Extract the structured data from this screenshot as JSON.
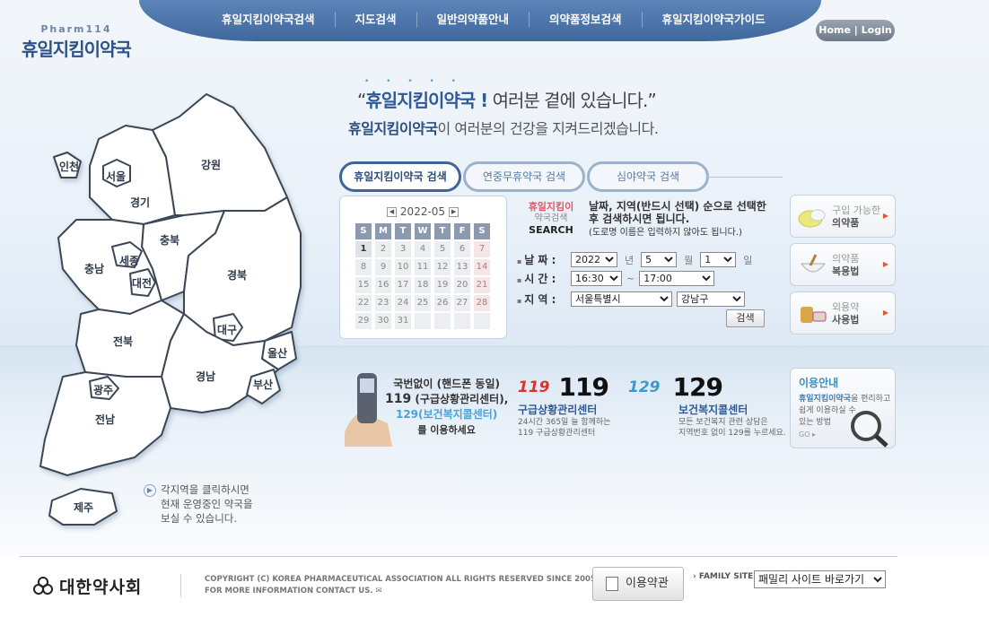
{
  "header": {
    "logo_sub": "Pharm114",
    "logo_main": "휴일지킴이약국",
    "home_login": "Home | Login",
    "nav": [
      "휴일지킴이약국검색",
      "지도검색",
      "일반의약품안내",
      "의약품정보검색",
      "휴일지킴이약국가이드"
    ]
  },
  "hero": {
    "headline_brand": "휴일지킴이약국 !",
    "headline_rest": "여러분 곁에 있습니다.",
    "headline_dots": "• • • • •",
    "sub_brand": "휴일지킴이약국",
    "sub_rest": "이 여러분의 건강을 지켜드리겠습니다."
  },
  "map": {
    "regions": [
      "인천",
      "서울",
      "경기",
      "강원",
      "충북",
      "충남",
      "세종",
      "대전",
      "경북",
      "대구",
      "울산",
      "전북",
      "경남",
      "광주",
      "부산",
      "전남",
      "제주"
    ],
    "note": [
      "각지역을 클릭하시면",
      "현재 운영중인 약국을",
      "보실 수 있습니다."
    ]
  },
  "tabs": [
    "휴일지킴이약국 검색",
    "연중무휴약국 검색",
    "심야약국 검색"
  ],
  "calendar": {
    "month": "2022-05",
    "dow": [
      "S",
      "M",
      "T",
      "W",
      "T",
      "F",
      "S"
    ],
    "days": [
      "1",
      "2",
      "3",
      "4",
      "5",
      "6",
      "7",
      "8",
      "9",
      "10",
      "11",
      "12",
      "13",
      "14",
      "15",
      "16",
      "17",
      "18",
      "19",
      "20",
      "21",
      "22",
      "23",
      "24",
      "25",
      "26",
      "27",
      "28",
      "29",
      "30",
      "31",
      "",
      "",
      "",
      ""
    ]
  },
  "search": {
    "logo_line1": "휴일지킴이",
    "logo_line2": "약국검색",
    "logo_line3": "SEARCH",
    "desc1": "날짜, 지역(반드시 선택) 순으로 선택한",
    "desc2": "후 검색하시면 됩니다.",
    "desc3": "(도로명 이름은 입력하지 않아도 됩니다.)",
    "date_label": "날 짜 :",
    "year": "2022",
    "year_unit": "년",
    "month": "5",
    "month_unit": "월",
    "day": "1",
    "day_unit": "일",
    "time_label": "시 간 :",
    "time_from": "16:30",
    "time_sep": "~",
    "time_to": "17:00",
    "region_label": "지 역 :",
    "city": "서울특별시",
    "district": "강남구",
    "button": "검색"
  },
  "side": [
    {
      "sub": "구입 가능한",
      "main": "의약품"
    },
    {
      "sub": "의약품",
      "main": "복용법"
    },
    {
      "sub": "외용약",
      "main": "사용법"
    }
  ],
  "emergency": {
    "phone_l1": "국번없이 (핸드폰 동일)",
    "phone_l2a": "119",
    "phone_l2b": "(구급상황관리센터),",
    "phone_l3": "129(보건복지콜센터)",
    "phone_l4": "를 이용하세요",
    "e119_logo": "119",
    "e119_num": "119",
    "e119_title": "구급상황관리센터",
    "e119_desc1": "24시간 365일 늘 함께하는",
    "e119_desc2": "119 구급상황관리센터",
    "e129_logo": "129",
    "e129_num": "129",
    "e129_title": "보건복지콜센터",
    "e129_desc1": "모든 보건복지 관련 상담은",
    "e129_desc2": "지역번호 없이 129를 누르세요."
  },
  "info": {
    "title": "이용안내",
    "l1a": "휴일지킴이약국",
    "l1b": "을 편리하고",
    "l2": "쉽게 이용하실 수",
    "l3": "있는 방법",
    "go": "GO ▸"
  },
  "footer": {
    "org": "대한약사회",
    "copy1": "COPYRIGHT (C) KOREA PHARMACEUTICAL ASSOCIATION ALL RIGHTS RESERVED SINCE 2005",
    "copy2": "FOR MORE INFORMATION CONTACT US.",
    "terms": "이용약관",
    "family_label": "FAMILY SITE",
    "family_select": "패밀리 사이트 바로가기"
  }
}
